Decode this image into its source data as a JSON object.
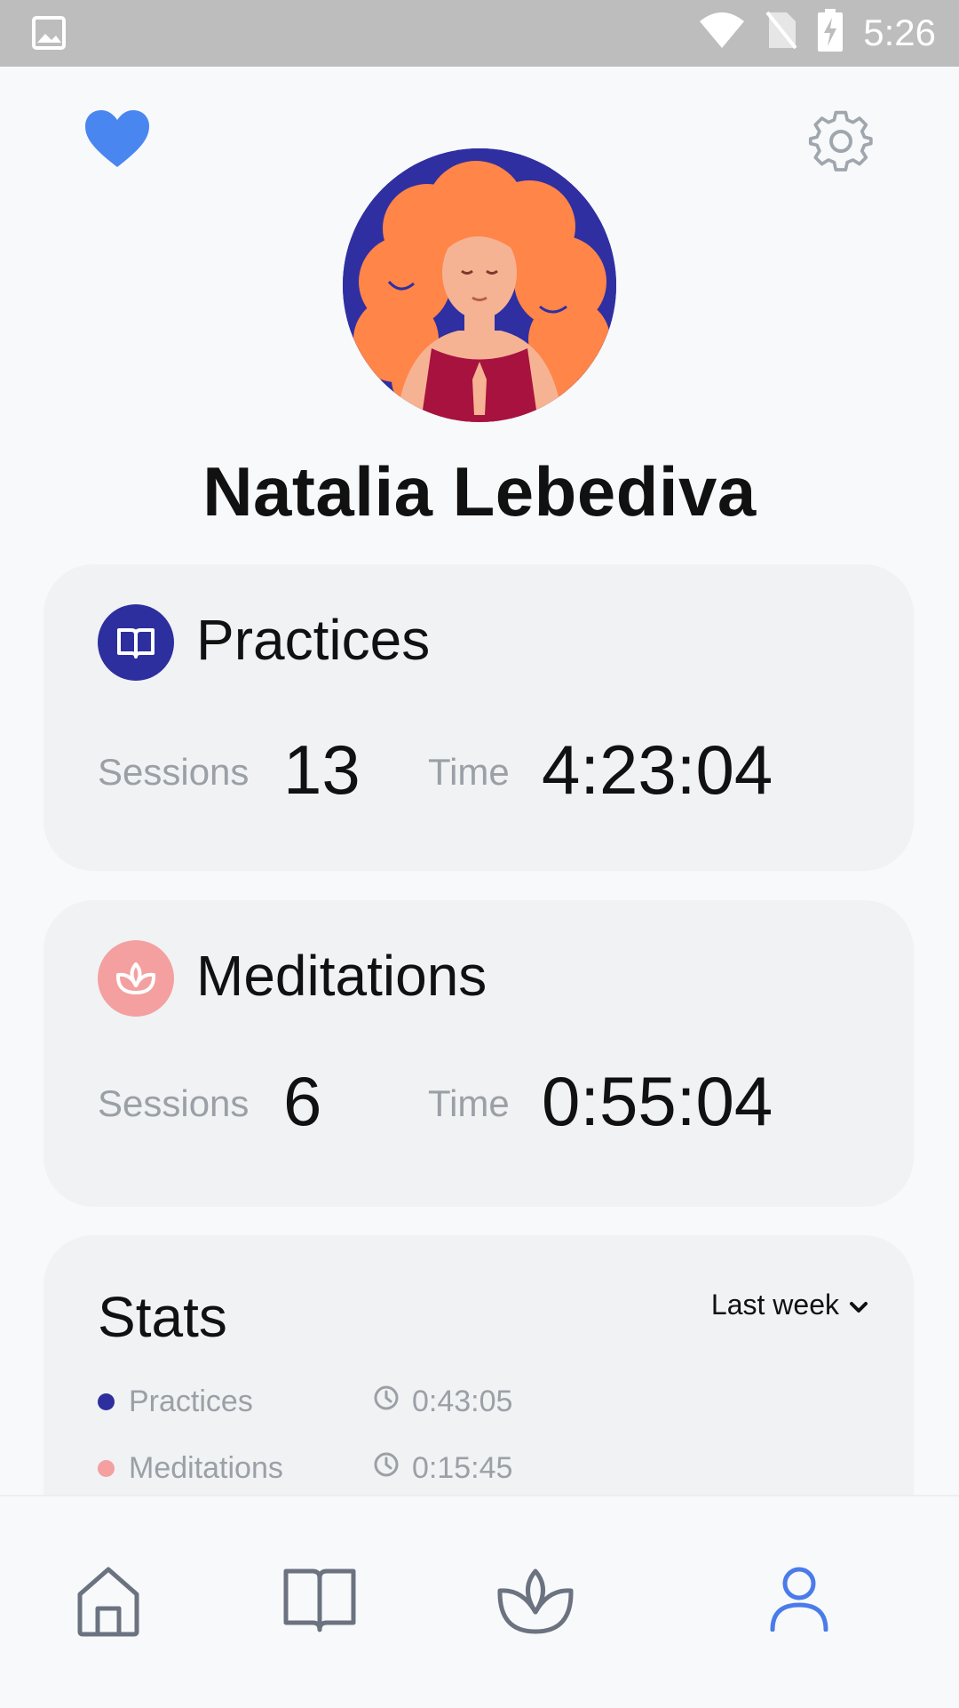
{
  "status_bar": {
    "time": "5:26",
    "icons": [
      "image-icon",
      "wifi-icon",
      "no-sim-icon",
      "battery-charging-icon"
    ]
  },
  "header": {
    "left_icon": "heart-icon",
    "right_icon": "gear-icon"
  },
  "profile": {
    "name": "Natalia Lebediva"
  },
  "practices": {
    "title": "Practices",
    "icon": "book-icon",
    "icon_color": "#2e2f9e",
    "sessions_label": "Sessions",
    "sessions_value": "13",
    "time_label": "Time",
    "time_value": "4:23:04"
  },
  "meditations": {
    "title": "Meditations",
    "icon": "lotus-icon",
    "icon_color": "#f4a0a0",
    "sessions_label": "Sessions",
    "sessions_value": "6",
    "time_label": "Time",
    "time_value": "0:55:04"
  },
  "stats": {
    "title": "Stats",
    "period": "Last week",
    "items": [
      {
        "label": "Practices",
        "time": "0:43:05",
        "color": "#2e2f9e"
      },
      {
        "label": "Meditations",
        "time": "0:15:45",
        "color": "#f4a0a0"
      }
    ]
  },
  "bottom_nav": {
    "items": [
      "home-icon",
      "book-icon",
      "lotus-icon",
      "profile-icon"
    ],
    "active": "profile-icon",
    "active_color": "#4a7bea",
    "inactive_color": "#6b7280"
  }
}
